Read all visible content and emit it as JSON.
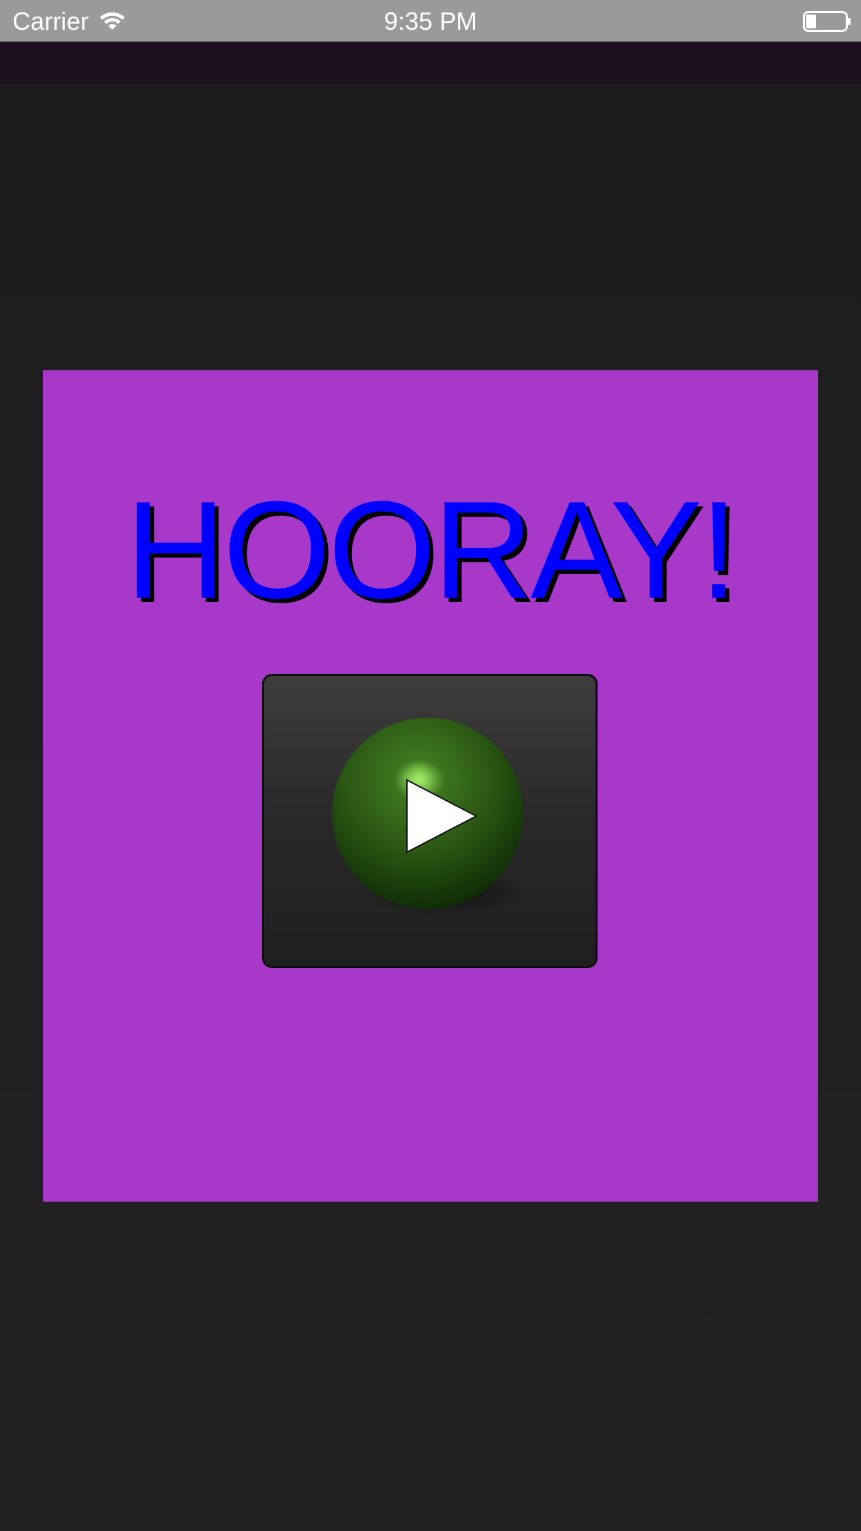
{
  "status_bar": {
    "carrier": "Carrier",
    "time": "9:35 PM",
    "wifi_icon": "wifi-icon",
    "battery_icon": "battery-icon",
    "battery_level": 0.25
  },
  "main": {
    "headline": "HOORAY!",
    "play_button_icon": "play-icon"
  },
  "colors": {
    "status_bar_bg": "#9a9a9a",
    "nav_bar_bg": "#1d0f1f",
    "page_bg": "#1e1e1e",
    "panel_bg": "#a838c9",
    "headline_text": "#0000ff",
    "headline_shadow": "#000000",
    "button_bg": "#2a2a2a",
    "orb_green": "#2e5e16"
  }
}
